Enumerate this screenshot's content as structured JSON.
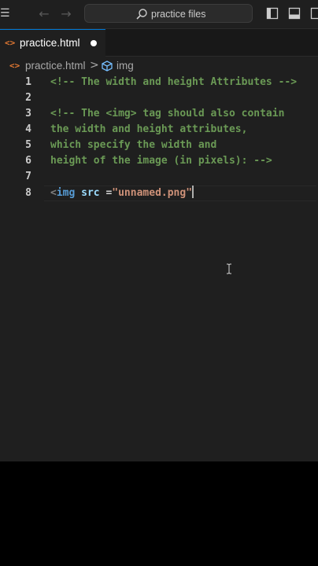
{
  "titlebar": {
    "search_text": "practice files"
  },
  "tab": {
    "label": "practice.html",
    "icon": "<>"
  },
  "breadcrumb": {
    "file": "practice.html",
    "separator": ">",
    "element": "img"
  },
  "editor": {
    "lines": [
      {
        "n": "1",
        "text": "<!-- The width and height Attributes -->"
      },
      {
        "n": "2",
        "text": ""
      },
      {
        "n": "3",
        "text": "<!-- The <img> tag should also contain"
      },
      {
        "n": "4",
        "text": "the width and height attributes,"
      },
      {
        "n": "5",
        "text": "which specify the width and"
      },
      {
        "n": "6",
        "text": "height of the image (in pixels): -->"
      },
      {
        "n": "7",
        "text": ""
      },
      {
        "n": "8",
        "tag_open": "<",
        "tag_name": "img",
        "attr": "src",
        "op": " =",
        "value": "\"unnamed.png\""
      }
    ]
  },
  "colors": {
    "accent": "#0078d4",
    "comment": "#6a9955",
    "tag": "#569cd6",
    "attribute": "#9cdcfe",
    "string": "#ce9178",
    "html_icon": "#e37933"
  }
}
